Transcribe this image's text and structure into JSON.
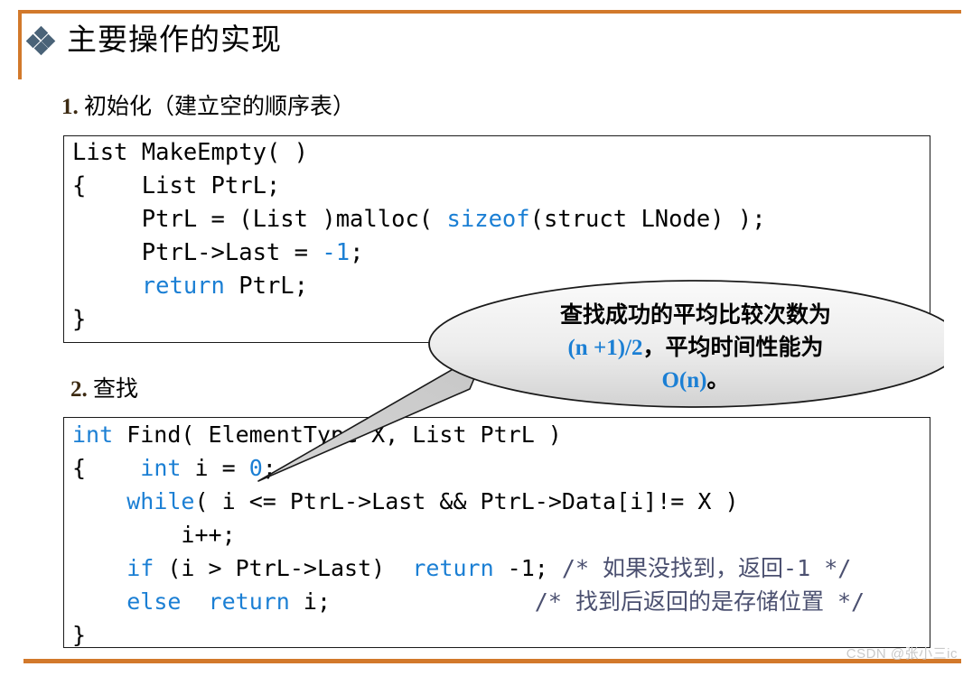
{
  "slide": {
    "title": "主要操作的实现",
    "bullet_icon": "four-diamond-bullet-icon",
    "accent_color": "#D2792B",
    "bullet_color": "#4A6378"
  },
  "sections": [
    {
      "number": "1.",
      "title": "初始化（建立空的顺序表）",
      "code_lines": [
        [
          {
            "t": "List MakeEmpty( )",
            "s": "plain"
          }
        ],
        [
          {
            "t": "{    List PtrL;",
            "s": "plain"
          }
        ],
        [
          {
            "t": "     PtrL = (List )malloc( ",
            "s": "plain"
          },
          {
            "t": "sizeof",
            "s": "kw"
          },
          {
            "t": "(struct LNode) );",
            "s": "plain"
          }
        ],
        [
          {
            "t": "     PtrL->Last = ",
            "s": "plain"
          },
          {
            "t": "-1",
            "s": "num"
          },
          {
            "t": ";",
            "s": "plain"
          }
        ],
        [
          {
            "t": "     ",
            "s": "plain"
          },
          {
            "t": "return",
            "s": "kw"
          },
          {
            "t": " PtrL;",
            "s": "plain"
          }
        ],
        [
          {
            "t": "}",
            "s": "plain"
          }
        ]
      ]
    },
    {
      "number": "2.",
      "title": "查找",
      "code_lines": [
        [
          {
            "t": "int",
            "s": "kw"
          },
          {
            "t": " Find( ElementType X, List PtrL )",
            "s": "plain"
          }
        ],
        [
          {
            "t": "{    ",
            "s": "plain"
          },
          {
            "t": "int",
            "s": "kw"
          },
          {
            "t": " i = ",
            "s": "plain"
          },
          {
            "t": "0",
            "s": "num"
          },
          {
            "t": ";",
            "s": "plain"
          }
        ],
        [
          {
            "t": "    ",
            "s": "plain"
          },
          {
            "t": "while",
            "s": "kw"
          },
          {
            "t": "( i <= PtrL->Last && PtrL->Data[i]!= X )",
            "s": "plain"
          }
        ],
        [
          {
            "t": "        i++;",
            "s": "plain"
          }
        ],
        [
          {
            "t": "    ",
            "s": "plain"
          },
          {
            "t": "if",
            "s": "kw"
          },
          {
            "t": " (i > PtrL->Last)  ",
            "s": "plain"
          },
          {
            "t": "return",
            "s": "kw"
          },
          {
            "t": " -1; ",
            "s": "plain"
          },
          {
            "t": "/* 如果没找到，返回-1 */",
            "s": "cmt"
          }
        ],
        [
          {
            "t": "    ",
            "s": "plain"
          },
          {
            "t": "else",
            "s": "kw"
          },
          {
            "t": "  ",
            "s": "plain"
          },
          {
            "t": "return",
            "s": "kw"
          },
          {
            "t": " i;",
            "s": "plain"
          },
          {
            "t": "           ",
            "s": "plain"
          },
          {
            "t": "    /* 找到后返回的是存储位置 */",
            "s": "cmt"
          }
        ],
        [
          {
            "t": "}",
            "s": "plain"
          }
        ]
      ]
    }
  ],
  "callout": {
    "line1": "查找成功的平均比较次数为",
    "line2_highlight": "(n +1)/2",
    "line2_rest": "，平均时间性能为",
    "line3_highlight": "O(n)",
    "line3_rest": "。",
    "highlight_color": "#1B7FD4",
    "fill_top": "#f5f5f5",
    "fill_bottom": "#d8d8d8"
  },
  "watermark": {
    "text": "CSDN @张小三ic"
  }
}
